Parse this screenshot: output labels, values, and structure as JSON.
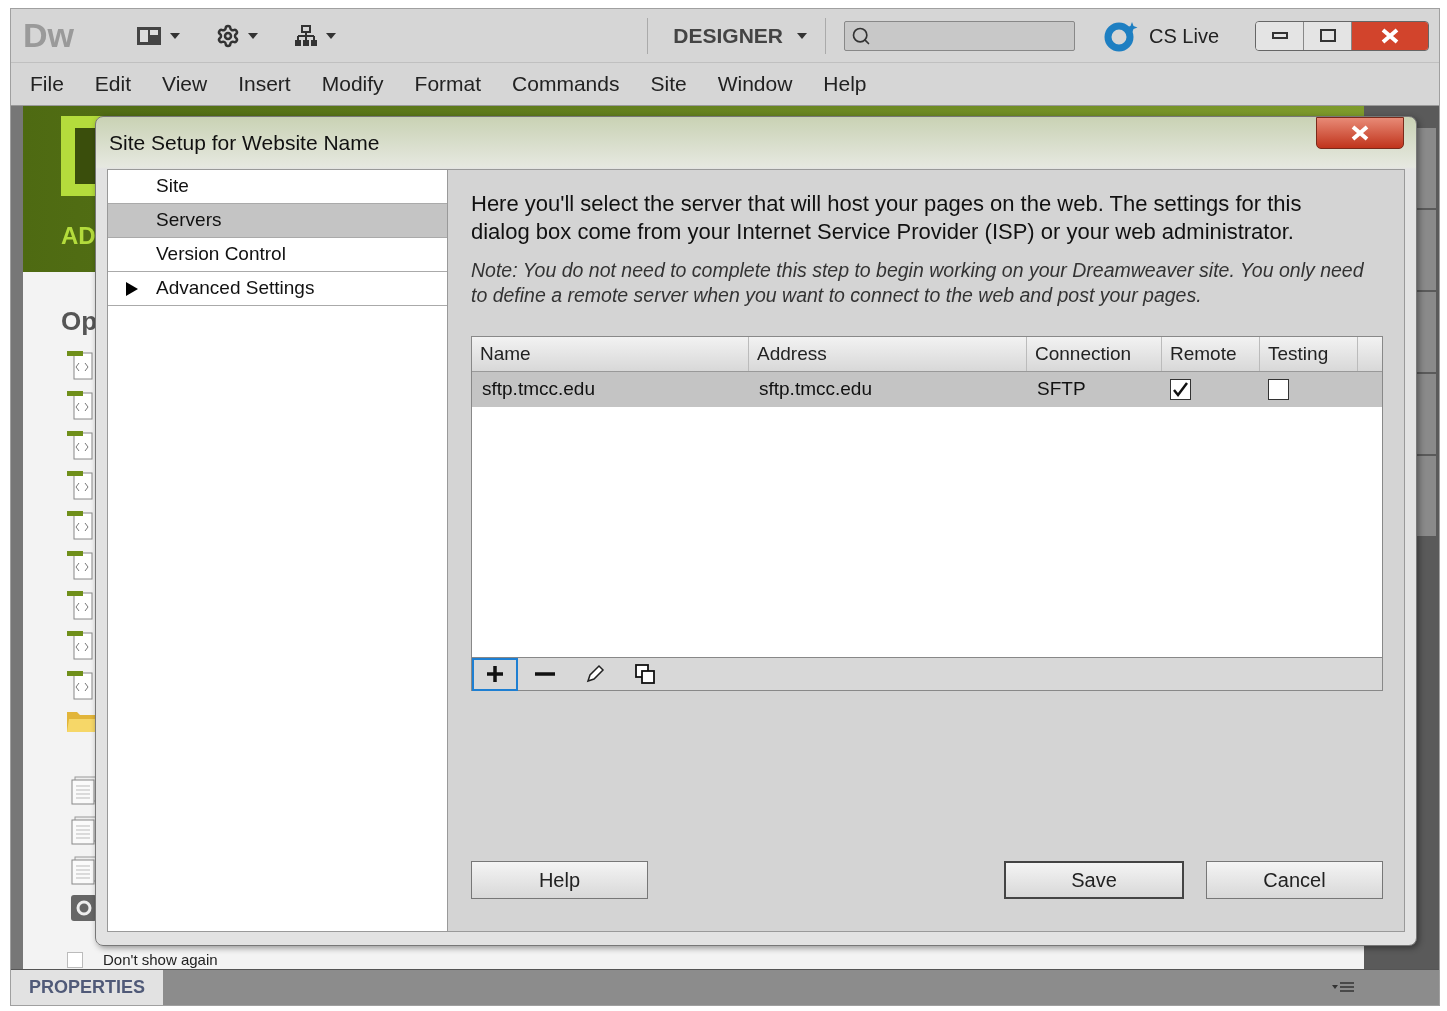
{
  "app": {
    "logo": "Dw",
    "workspace": "DESIGNER",
    "cs_live": "CS Live"
  },
  "menu": [
    "File",
    "Edit",
    "View",
    "Insert",
    "Modify",
    "Format",
    "Commands",
    "Site",
    "Window",
    "Help"
  ],
  "background": {
    "banner_text": "AD",
    "panel_heading": "Op",
    "dont_show": "Don't show again",
    "dont_show_checked": false,
    "properties_tab": "PROPERTIES"
  },
  "dialog": {
    "title": "Site Setup for Website Name",
    "nav": [
      {
        "label": "Site",
        "selected": false,
        "expandable": false
      },
      {
        "label": "Servers",
        "selected": true,
        "expandable": false
      },
      {
        "label": "Version Control",
        "selected": false,
        "expandable": false
      },
      {
        "label": "Advanced Settings",
        "selected": false,
        "expandable": true
      }
    ],
    "description": "Here you'll select the server that will host your pages on the web. The settings for this dialog box come from your Internet Service Provider (ISP) or your web administrator.",
    "note": "Note: You do not need to complete this step to begin working on your Dreamweaver site. You only need to define a remote server when you want to connect to the web and post your pages.",
    "table": {
      "columns": [
        "Name",
        "Address",
        "Connection",
        "Remote",
        "Testing"
      ],
      "rows": [
        {
          "name": "sftp.tmcc.edu",
          "address": "sftp.tmcc.edu",
          "connection": "SFTP",
          "remote": true,
          "testing": false,
          "selected": true
        }
      ]
    },
    "tools": [
      {
        "kind": "add",
        "focused": true
      },
      {
        "kind": "remove",
        "focused": false
      },
      {
        "kind": "edit",
        "focused": false
      },
      {
        "kind": "duplicate",
        "focused": false
      }
    ],
    "buttons": [
      {
        "label": "Help",
        "default": false
      },
      {
        "label": "Save",
        "default": true
      },
      {
        "label": "Cancel",
        "default": false
      }
    ]
  }
}
